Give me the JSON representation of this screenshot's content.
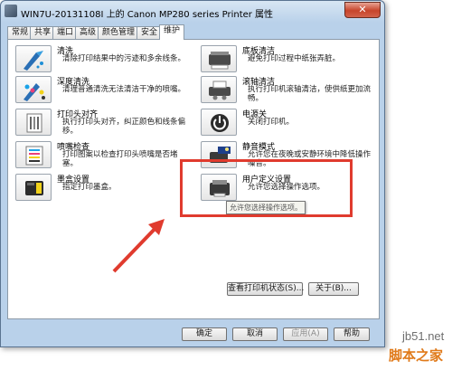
{
  "window": {
    "title": "WIN7U-20131108I 上的 Canon MP280 series Printer 属性",
    "close_label": "✕"
  },
  "tabs": [
    {
      "label": "常规"
    },
    {
      "label": "共享"
    },
    {
      "label": "端口"
    },
    {
      "label": "高级"
    },
    {
      "label": "颜色管理"
    },
    {
      "label": "安全"
    },
    {
      "label": "维护"
    }
  ],
  "items_left": [
    {
      "icon": "nozzle-cleaning-icon",
      "label": "清洗",
      "desc": "清除打印结果中的污迹和多余线条。"
    },
    {
      "icon": "deep-cleaning-icon",
      "label": "深度清洗",
      "desc": "清理普通清洗无法清洁干净的喷嘴。"
    },
    {
      "icon": "alignment-icon",
      "label": "打印头对齐",
      "desc": "执行打印头对齐，纠正颜色和线条偏移。"
    },
    {
      "icon": "nozzle-check-icon",
      "label": "喷嘴检查",
      "desc": "打印图案以检查打印头喷嘴是否堵塞。"
    },
    {
      "icon": "ink-cartridge-icon",
      "label": "墨盒设置",
      "desc": "指定打印墨盒。"
    }
  ],
  "items_right": [
    {
      "icon": "bottom-plate-cleaning-icon",
      "label": "底板清洁",
      "desc": "避免打印过程中纸张弄脏。"
    },
    {
      "icon": "roller-cleaning-icon",
      "label": "滚轴清洁",
      "desc": "执行打印机滚轴清洁，使供纸更加流畅。"
    },
    {
      "icon": "power-icon",
      "label": "电源关",
      "desc": "关闭打印机。"
    },
    {
      "icon": "quiet-mode-icon",
      "label": "静音模式",
      "desc": "允许您在夜晚或安静环境中降低操作噪音。"
    },
    {
      "icon": "custom-settings-icon",
      "label": "用户定义设置",
      "desc": "允许您选择操作选项。"
    }
  ],
  "tooltip": "允许您选择操作选项。",
  "buttons": {
    "status": "查看打印机状态(S)...",
    "about": "关于(B)...",
    "ok": "确定",
    "cancel": "取消",
    "apply": "应用(A)",
    "help": "帮助"
  },
  "watermark": {
    "site": "jb51.net",
    "brand": "脚本之家"
  },
  "colors": {
    "highlight": "#e03b2e",
    "title_bg": "#b9d1ea"
  }
}
